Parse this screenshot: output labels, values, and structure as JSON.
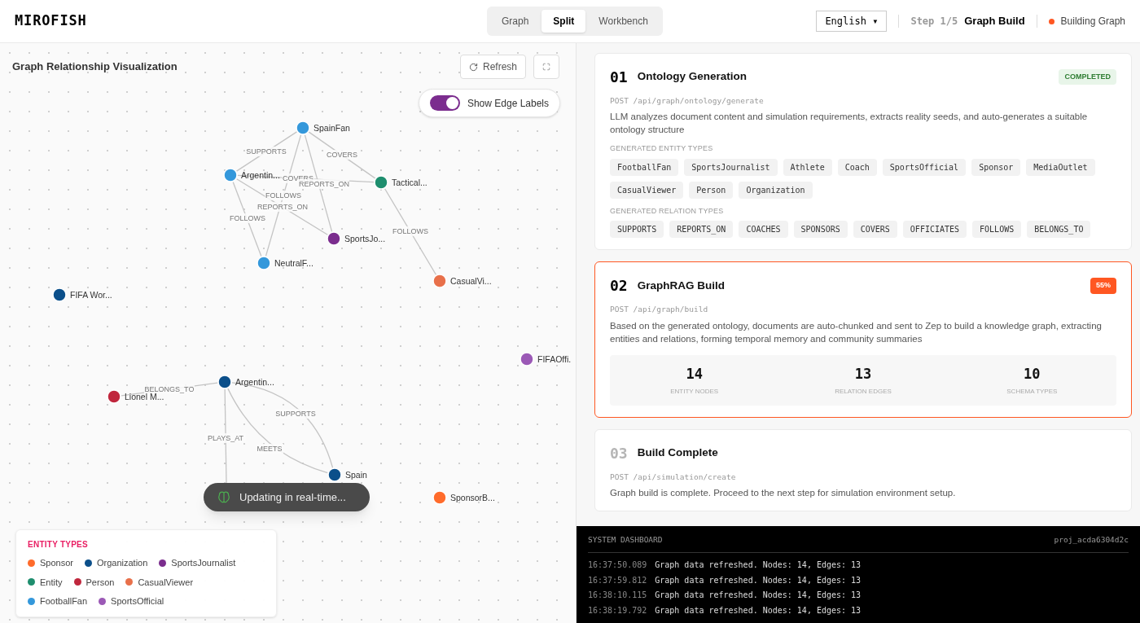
{
  "header": {
    "logo": "MIROFISH",
    "view_tabs": [
      {
        "label": "Graph",
        "selected": false
      },
      {
        "label": "Split",
        "selected": true
      },
      {
        "label": "Workbench",
        "selected": false
      }
    ],
    "language": "English ▾",
    "step": "Step 1/5",
    "step_name": "Graph Build",
    "status": "Building Graph"
  },
  "graph_panel": {
    "title": "Graph Relationship Visualization",
    "refresh_button": "Refresh",
    "edge_labels_toggle": {
      "label": "Show Edge Labels",
      "on": true
    },
    "nodes": [
      {
        "label": "SpainFan",
        "color": "#3498db"
      },
      {
        "label": "Argentin...",
        "color": "#3498db"
      },
      {
        "label": "Tactical...",
        "color": "#1e8e6e"
      },
      {
        "label": "SportsJo...",
        "color": "#7b2d8e"
      },
      {
        "label": "NeutralF...",
        "color": "#3498db"
      },
      {
        "label": "CasualVi...",
        "color": "#e8704a"
      },
      {
        "label": "FIFA Wor...",
        "color": "#0b4f8a"
      },
      {
        "label": "FIFAOffi.",
        "color": "#9b59b6"
      },
      {
        "label": "Argentin...",
        "color": "#0b4f8a"
      },
      {
        "label": "Lionel M...",
        "color": "#c0273d"
      },
      {
        "label": "Spain",
        "color": "#0b4f8a"
      },
      {
        "label": "SponsorB...",
        "color": "#ff6b2b"
      }
    ],
    "edges": [
      {
        "label": "SUPPORTS"
      },
      {
        "label": "COVERS"
      },
      {
        "label": "COVERS"
      },
      {
        "label": "REPORTS_ON"
      },
      {
        "label": "FOLLOWS"
      },
      {
        "label": "REPORTS_ON"
      },
      {
        "label": "FOLLOWS"
      },
      {
        "label": "FOLLOWS"
      },
      {
        "label": "BELONGS_TO"
      },
      {
        "label": "SUPPORTS"
      },
      {
        "label": "MEETS"
      },
      {
        "label": "PLAYS_AT"
      }
    ],
    "toast": "Updating in real-time...",
    "legend": {
      "title": "ENTITY TYPES",
      "items": [
        {
          "label": "Sponsor",
          "color": "#ff6b2b"
        },
        {
          "label": "Organization",
          "color": "#0b4f8a"
        },
        {
          "label": "SportsJournalist",
          "color": "#7b2d8e"
        },
        {
          "label": "Entity",
          "color": "#1e8e6e"
        },
        {
          "label": "Person",
          "color": "#c0273d"
        },
        {
          "label": "CasualViewer",
          "color": "#e8704a"
        },
        {
          "label": "FootballFan",
          "color": "#3498db"
        },
        {
          "label": "SportsOfficial",
          "color": "#9b59b6"
        }
      ]
    }
  },
  "steps": [
    {
      "number": "01",
      "title": "Ontology Generation",
      "completed": true,
      "active": false,
      "badge": "COMPLETED",
      "endpoint": "POST /api/graph/ontology/generate",
      "description": "LLM analyzes document content and simulation requirements, extracts reality seeds, and auto-generates a suitable ontology structure",
      "tag_groups": [
        {
          "title": "GENERATED ENTITY TYPES",
          "tags": [
            "FootballFan",
            "SportsJournalist",
            "Athlete",
            "Coach",
            "SportsOfficial",
            "Sponsor",
            "MediaOutlet",
            "CasualViewer",
            "Person",
            "Organization"
          ]
        },
        {
          "title": "GENERATED RELATION TYPES",
          "tags": [
            "SUPPORTS",
            "REPORTS_ON",
            "COACHES",
            "SPONSORS",
            "COVERS",
            "OFFICIATES",
            "FOLLOWS",
            "BELONGS_TO"
          ]
        }
      ]
    },
    {
      "number": "02",
      "title": "GraphRAG Build",
      "completed": false,
      "active": true,
      "badge": "55%",
      "endpoint": "POST /api/graph/build",
      "description": "Based on the generated ontology, documents are auto-chunked and sent to Zep to build a knowledge graph, extracting entities and relations, forming temporal memory and community summaries",
      "stats": [
        {
          "value": "14",
          "label": "ENTITY NODES"
        },
        {
          "value": "13",
          "label": "RELATION EDGES"
        },
        {
          "value": "10",
          "label": "SCHEMA TYPES"
        }
      ]
    },
    {
      "number": "03",
      "title": "Build Complete",
      "completed": false,
      "active": false,
      "endpoint": "POST /api/simulation/create",
      "description": "Graph build is complete. Proceed to the next step for simulation environment setup."
    }
  ],
  "dashboard": {
    "title": "SYSTEM DASHBOARD",
    "project": "proj_acda6304d2c",
    "logs": [
      {
        "time": "16:37:50.089",
        "message": "Graph data refreshed. Nodes: 14, Edges: 13"
      },
      {
        "time": "16:37:59.812",
        "message": "Graph data refreshed. Nodes: 14, Edges: 13"
      },
      {
        "time": "16:38:10.115",
        "message": "Graph data refreshed. Nodes: 14, Edges: 13"
      },
      {
        "time": "16:38:19.792",
        "message": "Graph data refreshed. Nodes: 14, Edges: 13"
      }
    ]
  }
}
